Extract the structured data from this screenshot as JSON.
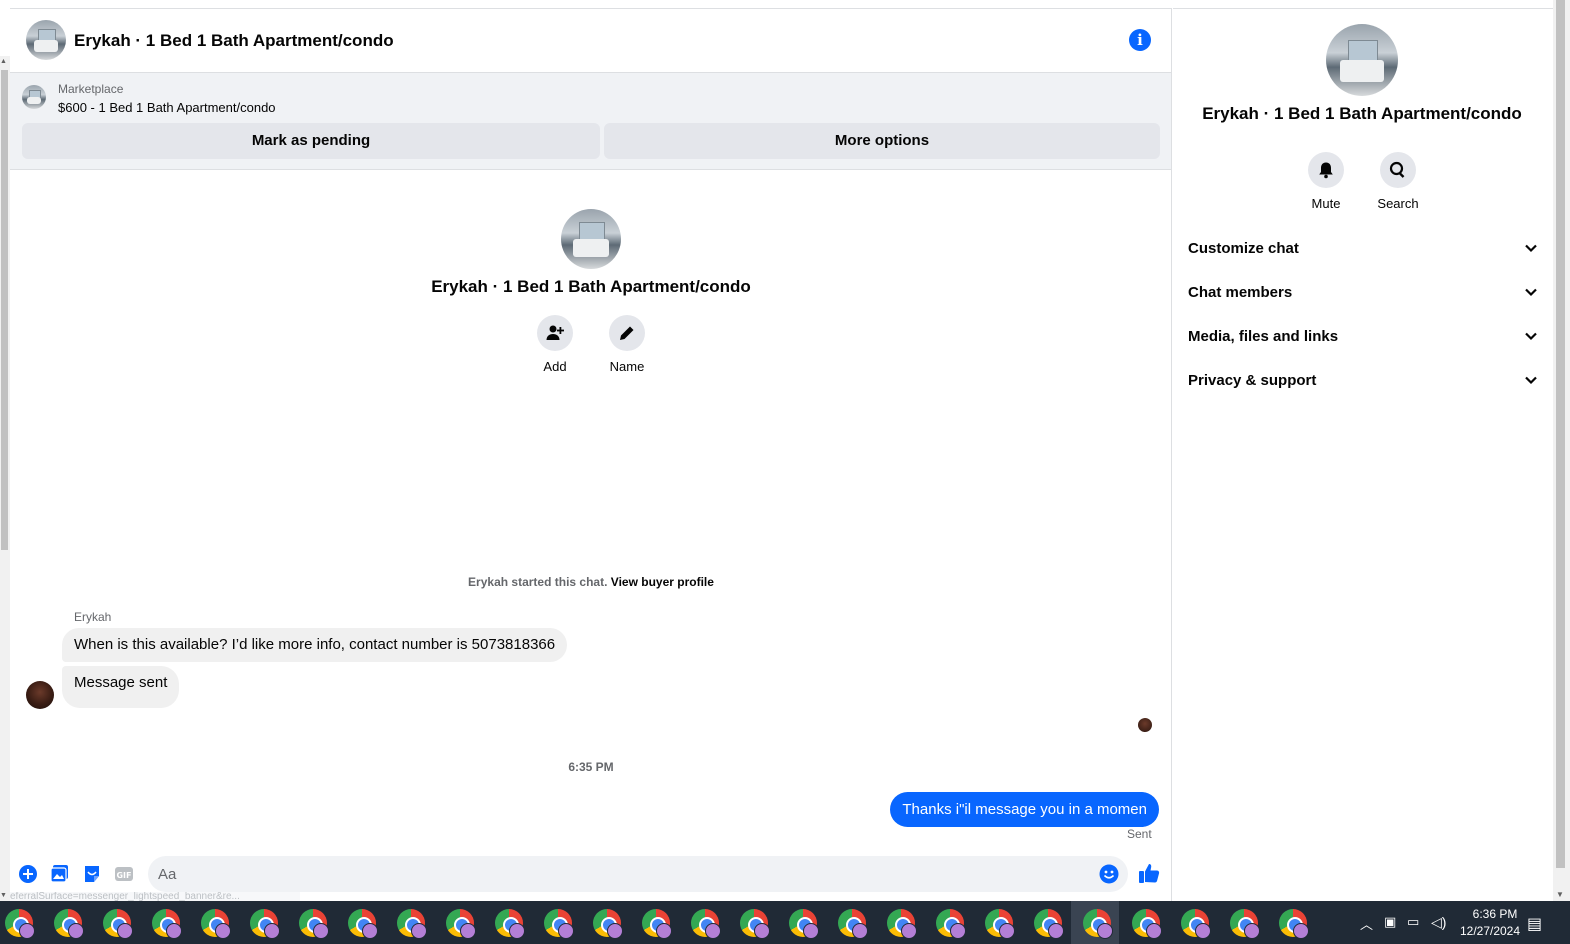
{
  "chat": {
    "title": "Erykah · 1 Bed 1 Bath Apartment/condo",
    "marketplace_label": "Marketplace",
    "listing": "$600 - 1 Bed 1 Bath Apartment/condo",
    "mark_pending": "Mark as pending",
    "more_options": "More options",
    "intro_name": "Erykah · 1 Bed 1 Bath Apartment/condo",
    "add_label": "Add",
    "name_label": "Name",
    "started_text": "Erykah started this chat.",
    "view_buyer": "View buyer profile",
    "sender": "Erykah",
    "messages_in": [
      "When is this available? I’d like more info, contact number is 5073818366",
      "Message sent"
    ],
    "time_separator": "6:35 PM",
    "message_out": "Thanks i\"il message you in a momen",
    "sent_status": "Sent",
    "input_placeholder": "Aa",
    "status_url": "eferralSurface=messenger_lightspeed_banner&re..."
  },
  "panel": {
    "name": "Erykah · 1 Bed 1 Bath Apartment/condo",
    "mute_label": "Mute",
    "search_label": "Search",
    "sections": [
      "Customize chat",
      "Chat members",
      "Media, files and links",
      "Privacy & support"
    ]
  },
  "taskbar": {
    "time": "6:36 PM",
    "date": "12/27/2024"
  },
  "colors": {
    "accent": "#0866ff",
    "bubble_in": "#f0f0f0",
    "taskbar": "#202a36"
  }
}
